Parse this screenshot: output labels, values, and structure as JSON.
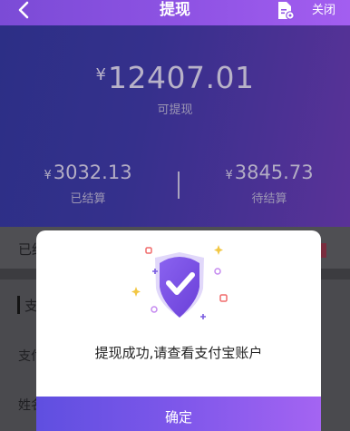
{
  "header": {
    "title": "提现",
    "close_label": "关闭",
    "back_icon": "chevron-left-icon",
    "doc_icon": "document-settings-icon"
  },
  "balance": {
    "currency": "¥",
    "available_amount": "12407.01",
    "available_label": "可提现",
    "settled": {
      "currency": "¥",
      "amount": "3032.13",
      "label": "已结算"
    },
    "pending": {
      "currency": "¥",
      "amount": "3845.73",
      "label": "待结算"
    }
  },
  "form": {
    "settled_row_text": "已结",
    "section_title": "支",
    "pay_row_label": "支付",
    "name_row_label": "姓名"
  },
  "dialog": {
    "message": "提现成功,请查看支付宝账户",
    "confirm_label": "确定",
    "illustration_icon": "check-badge-icon"
  },
  "colors": {
    "header_gradient_start": "#7b4bd6",
    "header_gradient_end": "#a35ef0",
    "button_gradient_start": "#5f4fe0",
    "button_gradient_end": "#a464f2",
    "badge": "#7a2d3e"
  }
}
